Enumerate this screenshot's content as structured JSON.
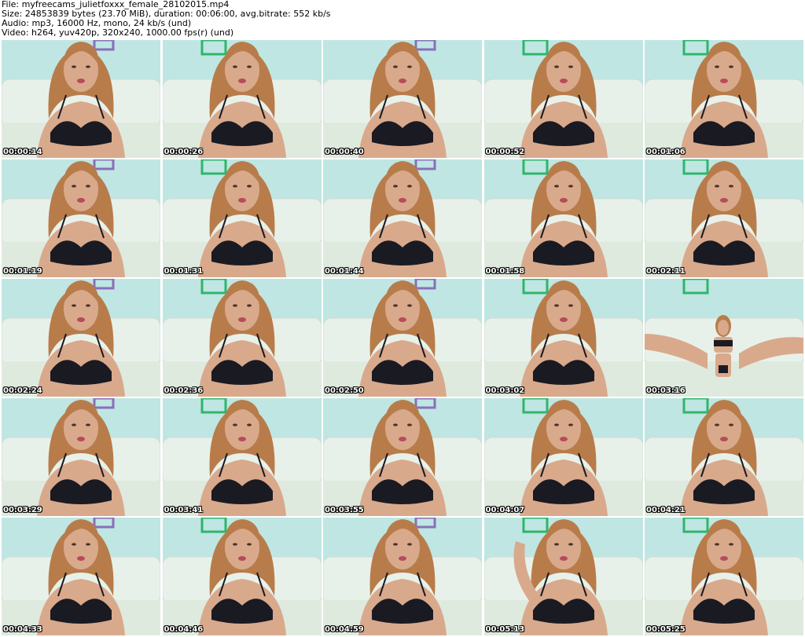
{
  "header": {
    "file_line": "File: myfreecams_julietfoxxx_female_28102015.mp4",
    "size_line": "Size: 24853839 bytes (23.70 MiB), duration: 00:06:00, avg.bitrate: 552 kb/s",
    "audio_line": "Audio: mp3, 16000 Hz, mono, 24 kb/s (und)",
    "video_line": "Video: h264, yuv420p, 320x240, 1000.00 fps(r) (und)"
  },
  "colors": {
    "background": "#ffffff",
    "wall": "#bfe6e3",
    "sofa": "#e8f1e9",
    "frame_accent_green": "#2fb56b",
    "frame_accent_purple": "#8a6fb8",
    "hair": "#b87c4a",
    "skin": "#d9a98c",
    "bra": "#1a1a22"
  },
  "thumbnails": [
    {
      "timestamp": "00:00:14",
      "variant": "standard"
    },
    {
      "timestamp": "00:00:26",
      "variant": "standard"
    },
    {
      "timestamp": "00:00:40",
      "variant": "standard"
    },
    {
      "timestamp": "00:00:52",
      "variant": "standard"
    },
    {
      "timestamp": "00:01:06",
      "variant": "standard"
    },
    {
      "timestamp": "00:01:19",
      "variant": "standard"
    },
    {
      "timestamp": "00:01:31",
      "variant": "standard"
    },
    {
      "timestamp": "00:01:44",
      "variant": "standard"
    },
    {
      "timestamp": "00:01:58",
      "variant": "standard"
    },
    {
      "timestamp": "00:02:11",
      "variant": "standard"
    },
    {
      "timestamp": "00:02:24",
      "variant": "standard"
    },
    {
      "timestamp": "00:02:36",
      "variant": "standard"
    },
    {
      "timestamp": "00:02:50",
      "variant": "standard"
    },
    {
      "timestamp": "00:03:02",
      "variant": "standard"
    },
    {
      "timestamp": "00:03:16",
      "variant": "seated"
    },
    {
      "timestamp": "00:03:29",
      "variant": "standard"
    },
    {
      "timestamp": "00:03:41",
      "variant": "standard"
    },
    {
      "timestamp": "00:03:55",
      "variant": "standard"
    },
    {
      "timestamp": "00:04:07",
      "variant": "standard"
    },
    {
      "timestamp": "00:04:21",
      "variant": "standard"
    },
    {
      "timestamp": "00:04:33",
      "variant": "standard"
    },
    {
      "timestamp": "00:04:46",
      "variant": "standard"
    },
    {
      "timestamp": "00:04:59",
      "variant": "standard"
    },
    {
      "timestamp": "00:05:13",
      "variant": "arm-raised"
    },
    {
      "timestamp": "00:05:25",
      "variant": "standard"
    }
  ]
}
